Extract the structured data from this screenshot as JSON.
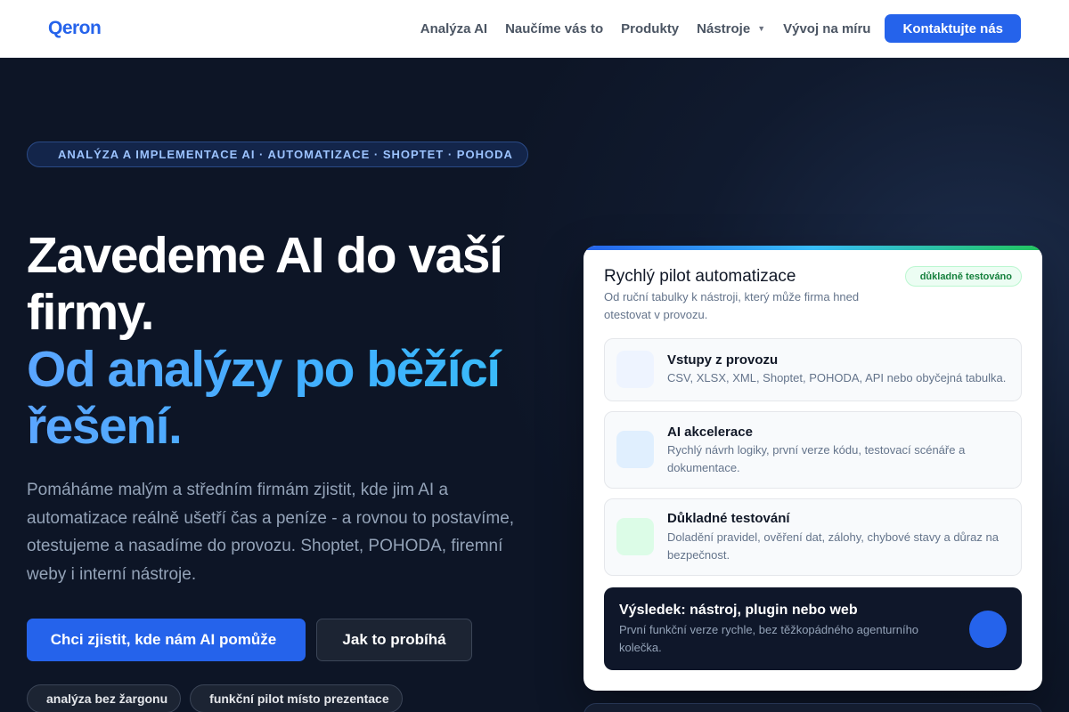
{
  "nav": {
    "logo": "Qeron",
    "links": [
      "Analýza AI",
      "Naučíme vás to",
      "Produkty",
      "Nástroje",
      "Vývoj na míru"
    ],
    "cta": "Kontaktujte nás"
  },
  "hero": {
    "eyebrow_icon": "",
    "eyebrow": "ANALÝZA A IMPLEMENTACE AI · AUTOMATIZACE · SHOPTET · POHODA",
    "title_white": "Zavedeme AI do vaší firmy.",
    "title_blue": "Od analýzy po běžící řešení.",
    "lead": "Pomáháme malým a středním firmám zjistit, kde jim AI a automatizace reálně ušetří čas a peníze - a rovnou to postavíme, otestujeme a nasadíme do provozu. Shoptet, POHODA, firemní weby i interní nástroje.",
    "primary_button": "Chci zjistit, kde nám AI pomůže",
    "primary_button_icon": "",
    "secondary_button": "Jak to probíhá",
    "chips": [
      {
        "icon": "",
        "label": "analýza bez žargonu"
      },
      {
        "icon": "",
        "label": "funkční pilot místo prezentace"
      }
    ]
  },
  "card": {
    "title": "Rychlý pilot automatizace",
    "subtitle": "Od ruční tabulky k nástroji, který může firma hned otestovat v provozu.",
    "badge_icon": "",
    "badge": "důkladně testováno",
    "steps": [
      {
        "icon": "",
        "title": "Vstupy z provozu",
        "desc": "CSV, XLSX, XML, Shoptet, POHODA, API nebo obyčejná tabulka."
      },
      {
        "icon": "",
        "title": "AI akcelerace",
        "desc": "Rychlý návrh logiky, první verze kódu, testovací scénáře a dokumentace."
      },
      {
        "icon": "",
        "title": "Důkladné testování",
        "desc": "Doladění pravidel, ověření dat, zálohy, chybové stavy a důraz na bezpečnost."
      }
    ],
    "result": {
      "title": "Výsledek: nástroj, plugin nebo web",
      "desc": "První funkční verze rychle, bez těžkopádného agenturního kolečka.",
      "button_icon": ""
    }
  },
  "colors": {
    "accent": "#2563eb",
    "hero_bg": "#0d1526",
    "title_blue": "#3fb0ff",
    "success": "#15803d"
  }
}
